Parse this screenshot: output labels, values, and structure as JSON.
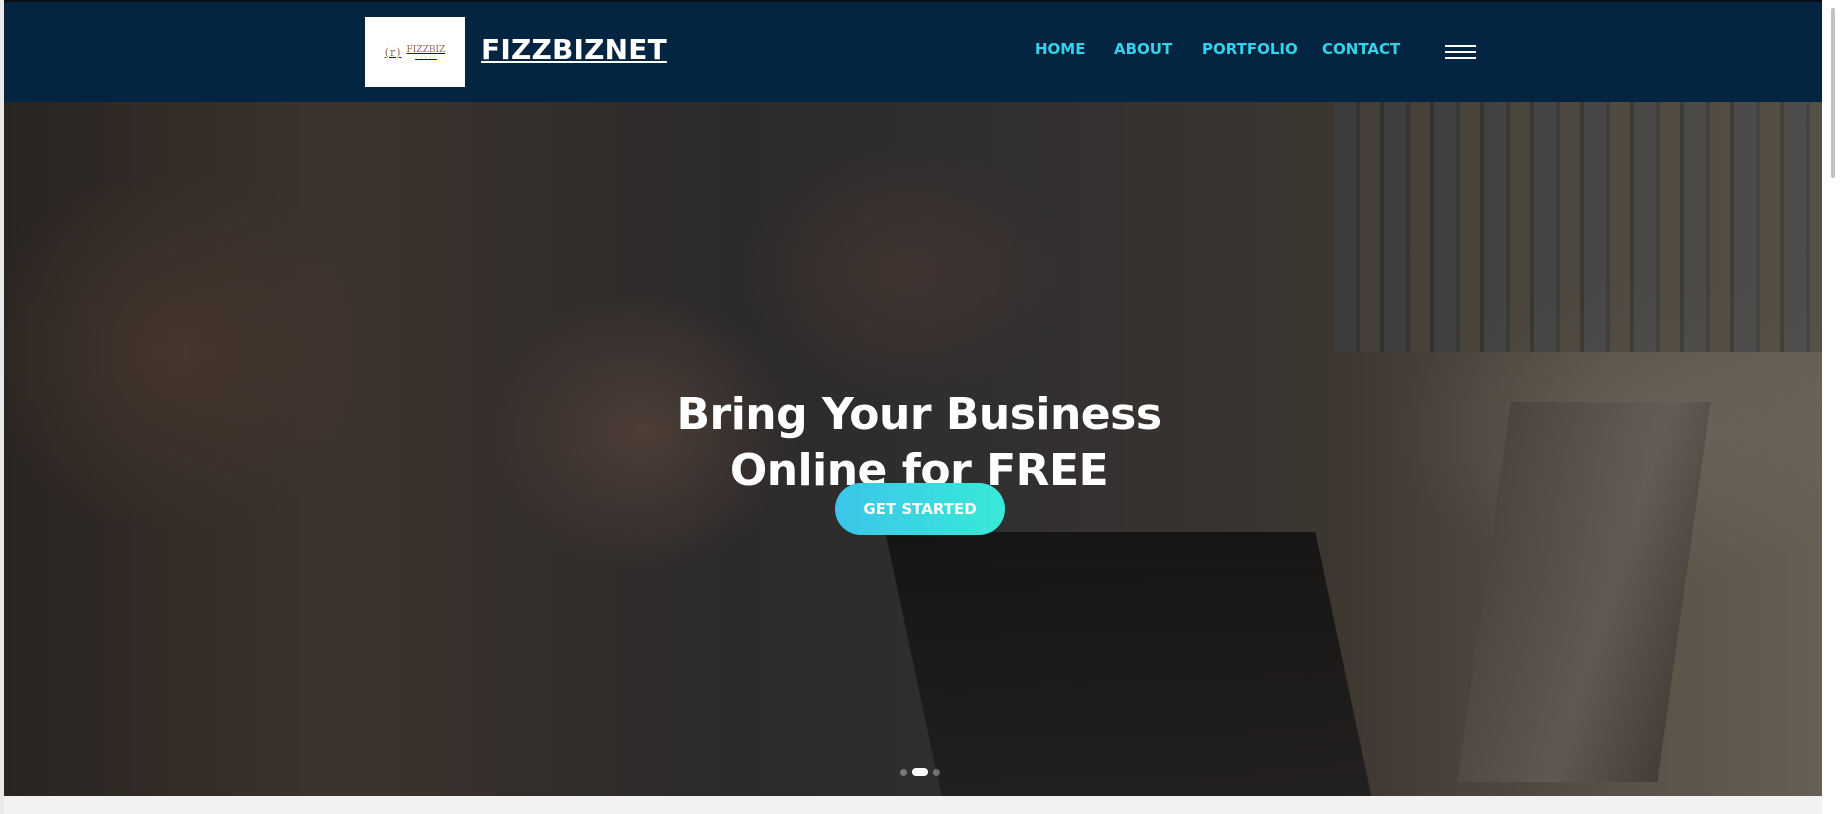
{
  "header": {
    "brand": {
      "logo_text": "FIZZBIZ",
      "logo_symbol": "(r)",
      "site_name": "FIZZBIZNET"
    },
    "nav": [
      {
        "label": "HOME"
      },
      {
        "label": "ABOUT"
      },
      {
        "label": "PORTFOLIO"
      },
      {
        "label": "CONTACT"
      }
    ],
    "menu_icon": "hamburger-menu-icon",
    "background_color": "#042541",
    "nav_color": "#33d3ec"
  },
  "hero": {
    "title_line1": "Bring Your Business",
    "title_line2": "Online for FREE",
    "cta_label": "GET STARTED",
    "cta_gradient": [
      "#3bc5ea",
      "#37ead7"
    ],
    "slides": {
      "count": 3,
      "active_index": 1
    }
  }
}
